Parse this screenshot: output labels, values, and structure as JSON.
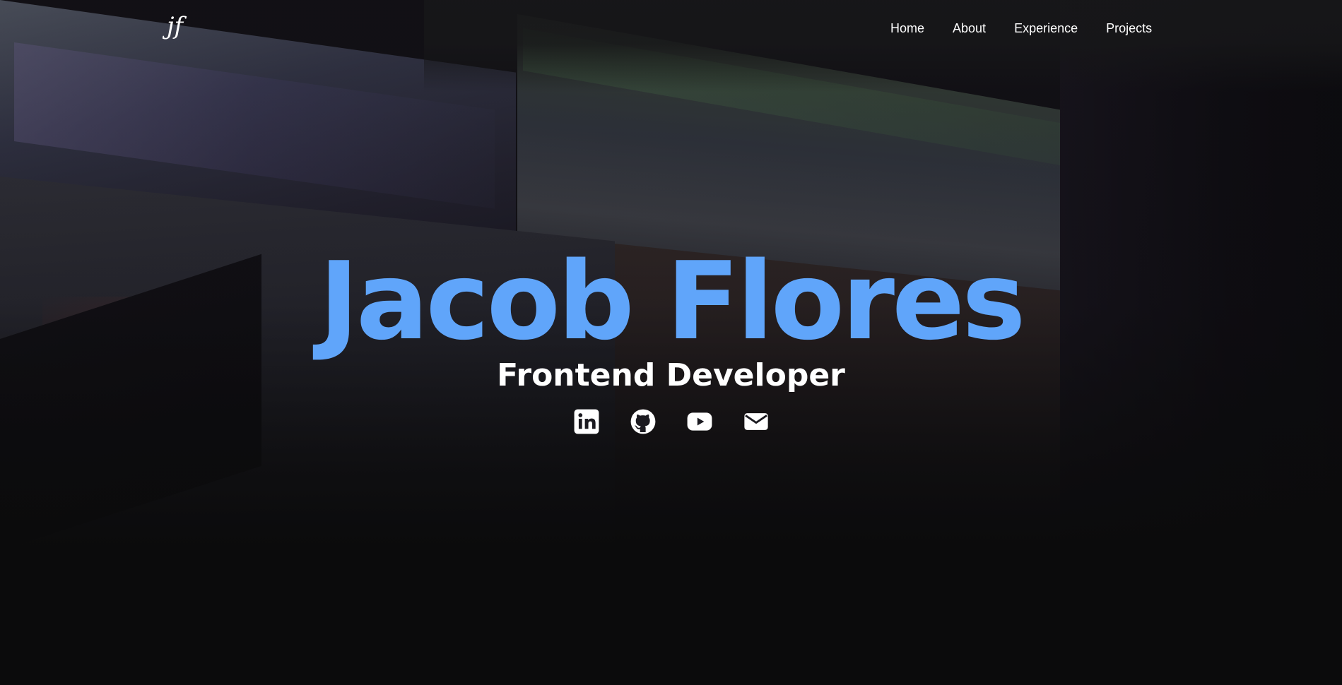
{
  "brand": {
    "logo_text": "jf"
  },
  "nav": {
    "items": [
      {
        "label": "Home"
      },
      {
        "label": "About"
      },
      {
        "label": "Experience"
      },
      {
        "label": "Projects"
      }
    ]
  },
  "hero": {
    "name": "Jacob Flores",
    "role": "Frontend Developer",
    "socials": [
      {
        "icon": "linkedin-icon"
      },
      {
        "icon": "github-icon"
      },
      {
        "icon": "youtube-icon"
      },
      {
        "icon": "mail-icon"
      }
    ]
  },
  "colors": {
    "accent": "#60a5fa",
    "text": "#ffffff",
    "background": "#0b0b0c"
  }
}
